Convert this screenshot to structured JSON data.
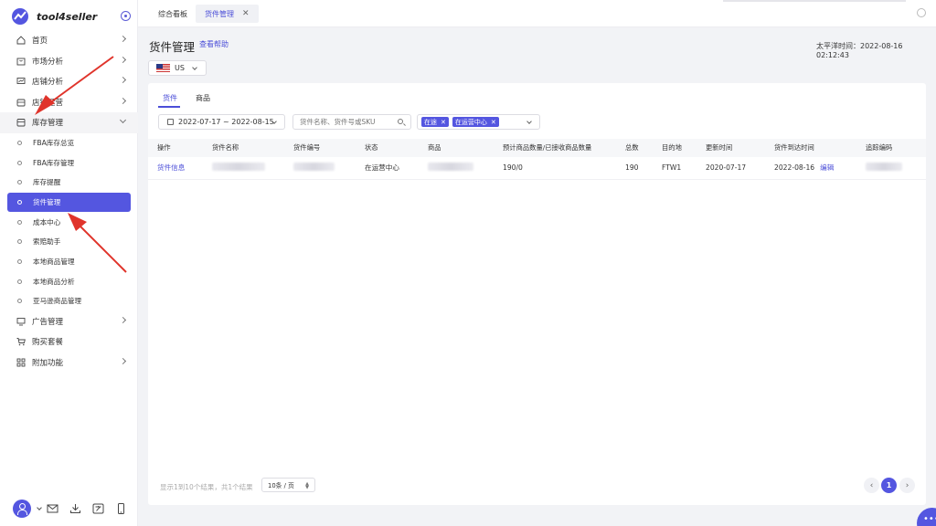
{
  "app": {
    "name": "tool4seller",
    "brand_color": "#5456e0"
  },
  "sidebar": {
    "items": [
      {
        "label": "首页",
        "icon": "home-icon",
        "has_arrow": true
      },
      {
        "label": "市场分析",
        "icon": "bag-icon",
        "has_arrow": true
      },
      {
        "label": "店铺分析",
        "icon": "chart-icon",
        "has_arrow": true
      },
      {
        "label": "店铺运营",
        "icon": "store-icon",
        "has_arrow": true
      },
      {
        "label": "库存管理",
        "icon": "box-icon",
        "expanded": true
      }
    ],
    "sub_items": [
      {
        "label": "FBA库存总览"
      },
      {
        "label": "FBA库存管理"
      },
      {
        "label": "库存提醒"
      },
      {
        "label": "货件管理",
        "active": true
      },
      {
        "label": "成本中心"
      },
      {
        "label": "索赔助手"
      },
      {
        "label": "本地商品管理"
      },
      {
        "label": "本地商品分析"
      },
      {
        "label": "亚马逊商品管理"
      }
    ],
    "bottom_items": [
      {
        "label": "广告管理",
        "icon": "monitor-icon",
        "has_arrow": true
      },
      {
        "label": "购买套餐",
        "icon": "cart-icon",
        "has_arrow": false
      },
      {
        "label": "附加功能",
        "icon": "grid-icon",
        "has_arrow": true
      }
    ]
  },
  "tabs": [
    {
      "label": "综合看板"
    },
    {
      "label": "货件管理",
      "close": "✕"
    }
  ],
  "header": {
    "title": "货件管理",
    "help": "查看帮助",
    "timezone_time": "太平洋时间：2022-08-16 02:12:43",
    "country": "US"
  },
  "content_tabs": [
    "货件",
    "商品"
  ],
  "filters": {
    "date_range": "2022-07-17 ~ 2022-08-15",
    "search_placeholder": "货件名称、货件号或SKU",
    "status_chips": [
      "在途",
      "在运营中心"
    ],
    "chip_close": "✕"
  },
  "table": {
    "columns": [
      "操作",
      "货件名称",
      "货件编号",
      "状态",
      "商品",
      "预计商品数量/已接收商品数量",
      "总数",
      "目的地",
      "更新时间",
      "货件到达时间",
      "追踪编码"
    ],
    "rows": [
      {
        "action": "货件信息",
        "status": "在运营中心",
        "qty": "190/0",
        "total": "190",
        "destination": "FTW1",
        "updated": "2020-07-17",
        "arrival": "2022-08-16",
        "edit": "编辑"
      }
    ]
  },
  "pagination": {
    "summary": "显示1到10个结果，共1个结果",
    "page_size": "10条 / 页",
    "prev": "‹",
    "current": "1",
    "next": "›"
  },
  "fab": {
    "label": "•••"
  }
}
